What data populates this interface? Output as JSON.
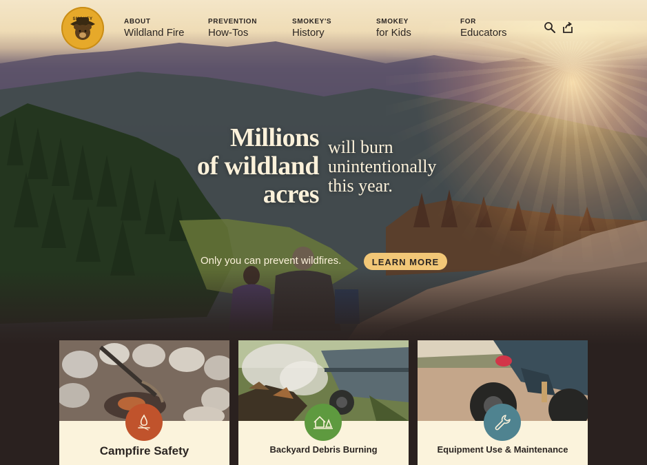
{
  "logo": {
    "text": "SMOKEY"
  },
  "nav": [
    {
      "small": "About",
      "big": "Wildland Fire"
    },
    {
      "small": "Prevention",
      "big": "How-Tos"
    },
    {
      "small": "Smokey's",
      "big": "History"
    },
    {
      "small": "Smokey",
      "big": "for Kids"
    },
    {
      "small": "For",
      "big": "Educators"
    }
  ],
  "hero": {
    "headline_bold_1": "Millions",
    "headline_bold_2": "of wildland",
    "headline_bold_3": "acres",
    "headline_light_1": "will burn",
    "headline_light_2": "unintentionally",
    "headline_light_3": "this year.",
    "tagline": "Only you can prevent wildfires.",
    "cta": "LEARN MORE"
  },
  "cards": [
    {
      "title": "Campfire Safety",
      "icon": "campfire-icon",
      "color": "#c0532c"
    },
    {
      "title": "Backyard Debris Burning",
      "icon": "house-trees-icon",
      "color": "#5e9a3f"
    },
    {
      "title": "Equipment Use & Maintenance",
      "icon": "wrench-icon",
      "color": "#4f8390"
    }
  ],
  "colors": {
    "cream": "#fbf1da",
    "cta": "#f2c777",
    "dark": "#2a211f",
    "logo": "#e6a92a"
  }
}
